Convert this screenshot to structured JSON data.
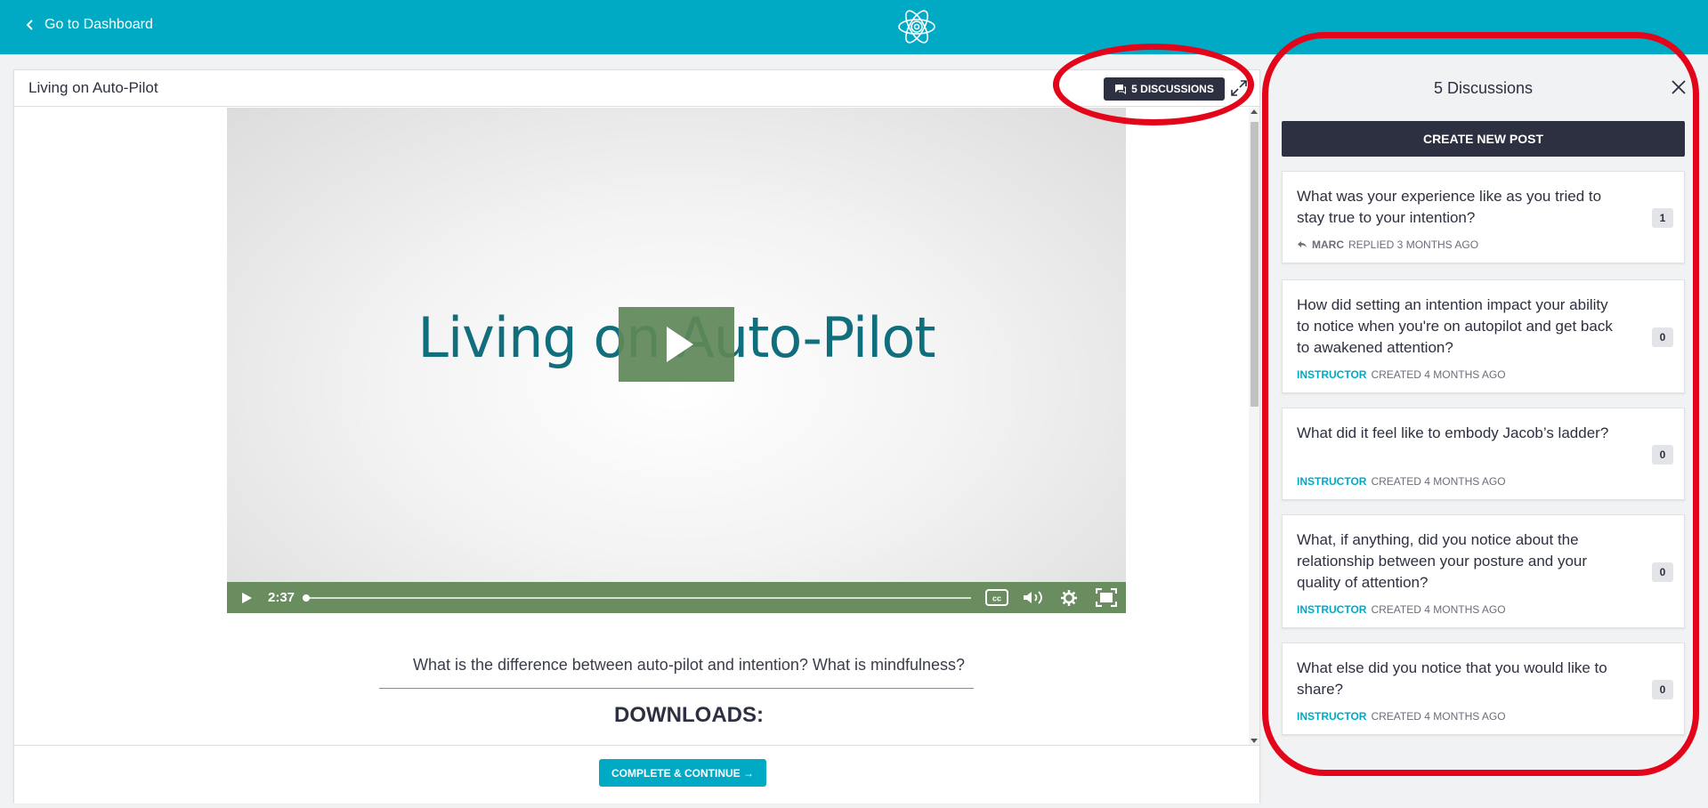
{
  "topbar": {
    "back_label": "Go to Dashboard",
    "bg": "#00aac5"
  },
  "lesson": {
    "title": "Living on Auto-Pilot",
    "discussions_badge": "5 DISCUSSIONS",
    "video": {
      "title_text": "Living on Auto-Pilot",
      "time": "2:37",
      "progress": 0.0
    },
    "question": "What is the difference between auto-pilot and intention? What is mindfulness?",
    "downloads_heading": "DOWNLOADS:",
    "complete_button": "COMPLETE & CONTINUE →"
  },
  "sidebar": {
    "title": "5 Discussions",
    "create_button": "CREATE NEW POST",
    "posts": [
      {
        "question": "What was your experience like as you tried to stay true to your intention?",
        "author": "MARC",
        "action": "REPLIED 3 MONTHS AGO",
        "count": "1",
        "icon": "reply-icon"
      },
      {
        "question": "How did setting an intention impact your ability to notice when you're on autopilot and get back to awakened attention?",
        "author": "INSTRUCTOR",
        "action": "CREATED 4 MONTHS AGO",
        "count": "0"
      },
      {
        "question": "What did it feel like to embody Jacob’s ladder?",
        "author": "INSTRUCTOR",
        "action": "CREATED 4 MONTHS AGO",
        "count": "0"
      },
      {
        "question": "What, if anything, did you notice about the relationship between your posture and your quality of attention?",
        "author": "INSTRUCTOR",
        "action": "CREATED 4 MONTHS AGO",
        "count": "0"
      },
      {
        "question": "What else did you notice that you would like to share?",
        "author": "INSTRUCTOR",
        "action": "CREATED 4 MONTHS AGO",
        "count": "0"
      }
    ]
  },
  "colors": {
    "accent": "#00aac5",
    "dark": "#2d3040",
    "video_controls": "#6a8d60",
    "annotation": "#e3061b"
  }
}
